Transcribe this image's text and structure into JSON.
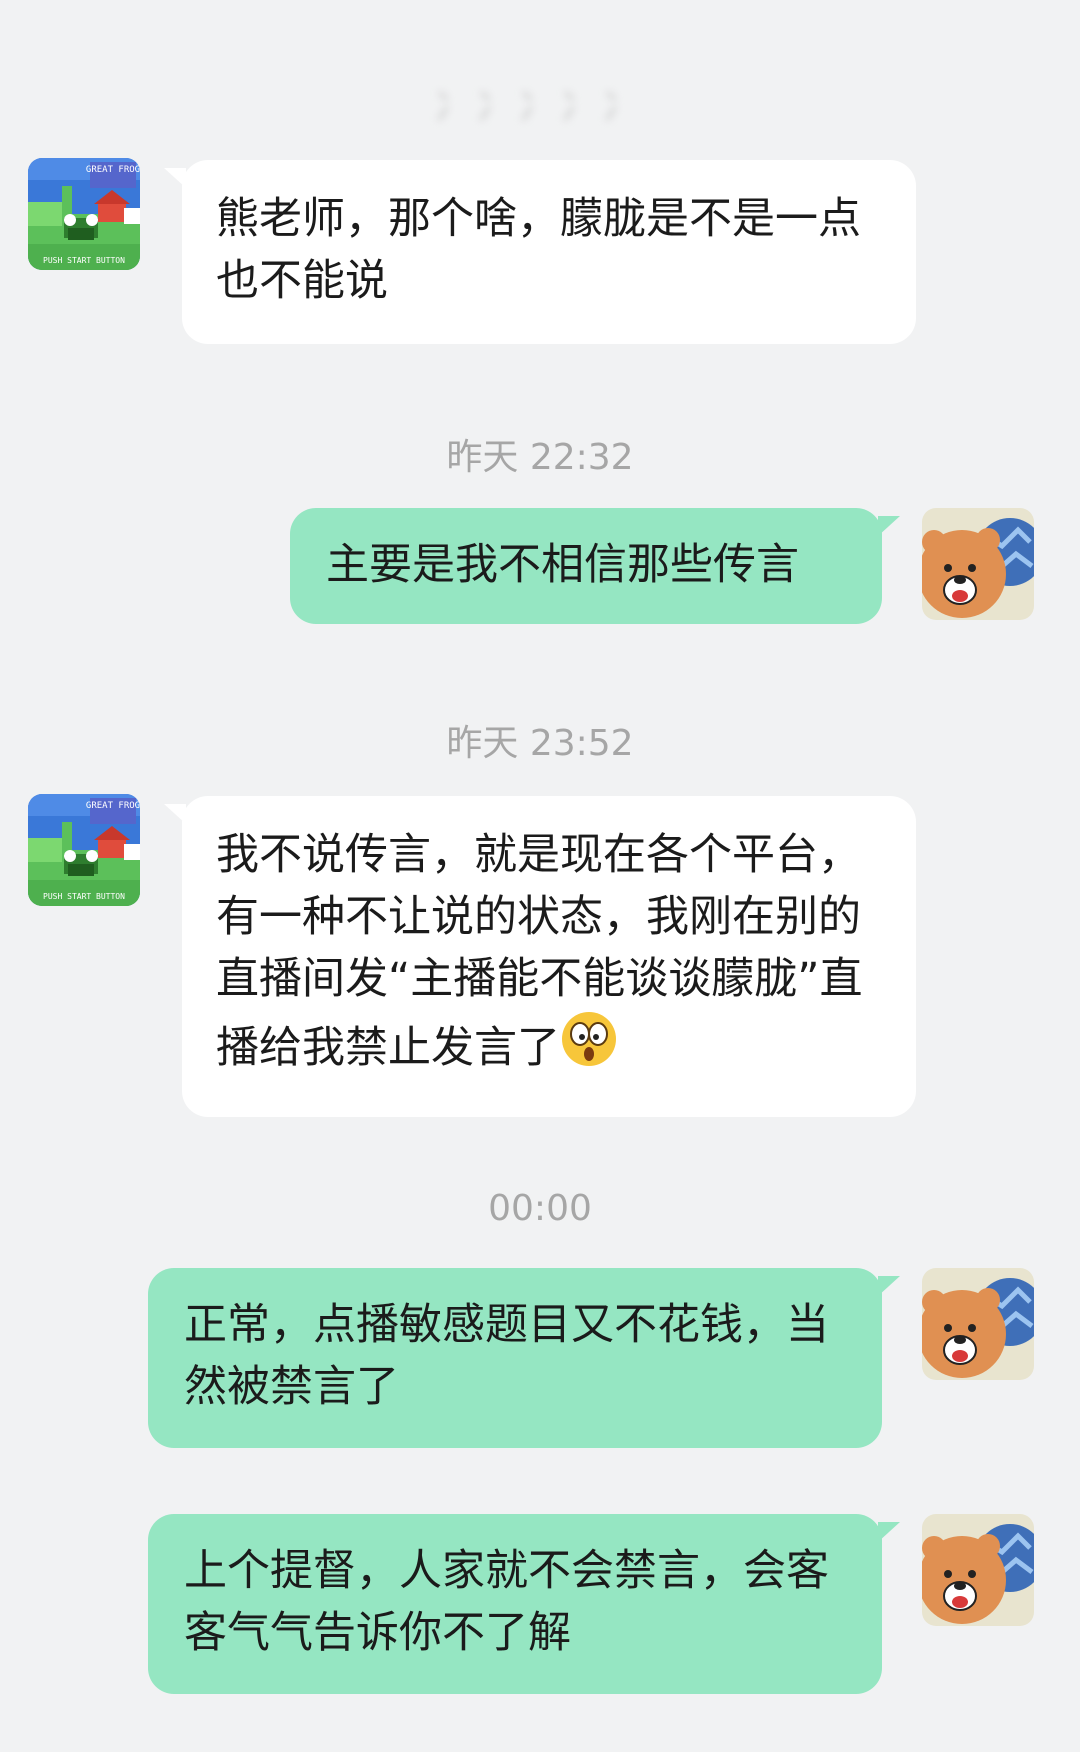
{
  "chat": {
    "contact_name": "冫冫冫冫冫",
    "messages": [
      {
        "sender": "contact",
        "text": "熊老师，那个啥，朦胧是不是一点也不能说"
      },
      {
        "timestamp": "昨天 22:32"
      },
      {
        "sender": "me",
        "text": "主要是我不相信那些传言"
      },
      {
        "timestamp": "昨天 23:52"
      },
      {
        "sender": "contact",
        "text": "我不说传言，就是现在各个平台，有一种不让说的状态，我刚在别的直播间发“主播能不能谈谈朦胧”直播给我禁止发言了",
        "emoji": "shocked-face"
      },
      {
        "timestamp": "00:00"
      },
      {
        "sender": "me",
        "text": "正常，点播敏感题目又不花钱，当然被禁言了"
      },
      {
        "sender": "me",
        "text": "上个提督，人家就不会禁言，会客客气气告诉你不了解"
      }
    ]
  },
  "avatars": {
    "contact": {
      "icon": "pixel-frog-game-avatar",
      "caption": "GREAT FROG",
      "subcaption": "PUSH START BUTTON"
    },
    "me": {
      "icon": "cartoon-bear-avatar"
    }
  },
  "colors": {
    "background": "#f1f2f3",
    "incoming_bubble": "#ffffff",
    "outgoing_bubble": "#95e6c2",
    "timestamp_text": "#a6a6a6"
  }
}
